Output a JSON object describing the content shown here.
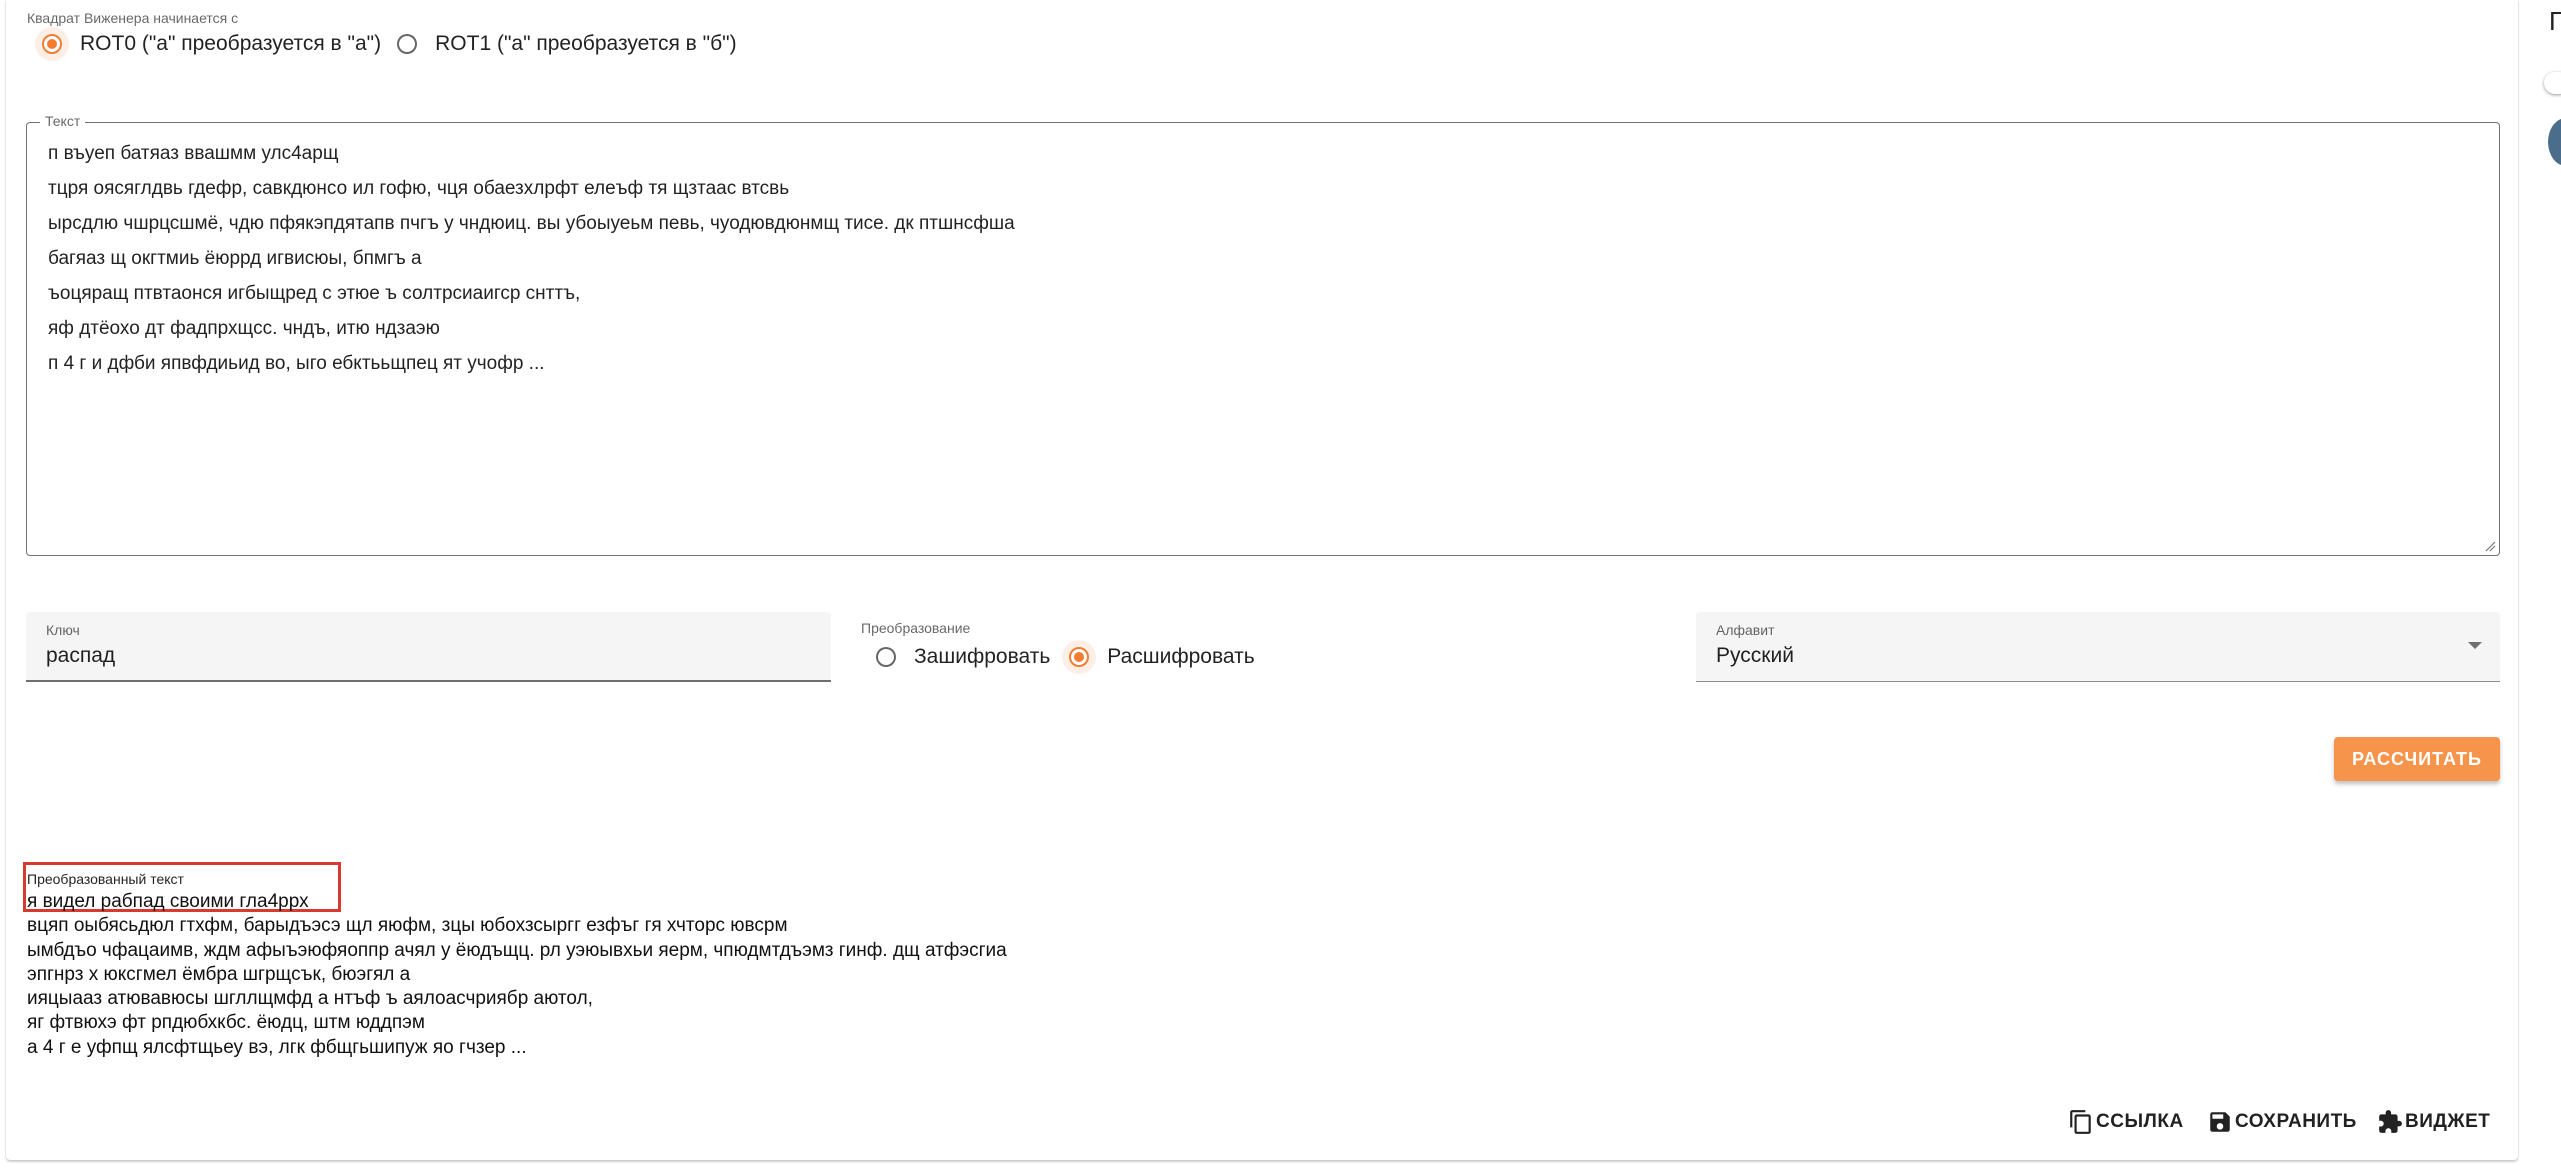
{
  "settings": {
    "square_start_label": "Квадрат Виженера начинается с",
    "rot_options": [
      {
        "label": "ROT0 (\"а\" преобразуется в \"а\")",
        "checked": true
      },
      {
        "label": "ROT1 (\"а\" преобразуется в \"б\")",
        "checked": false
      }
    ]
  },
  "text_input": {
    "label": "Текст",
    "lines": [
      "п въуеп батяаз ввашмм улс4арщ",
      "тцря оясяглдвь гдефр, савкдюнсо ил гофю, чця обаезхлрфт елеъф тя щзтаас втсвь",
      "ырсдлю чшрцсшмё, чдю пфякэпдятапв пчгъ у чндюиц. вы убоыуеьм певь, чуодювдюнмщ тисе. дк птшнсфша",
      "багяаз щ окгтмиь ёюррд игвисюы, бпмгъ а",
      "ъоцяращ птвтаонся игбыщред с этюе ъ солтрсиаигср снттъ,",
      "яф дтёохо дт фадпрхщсс. чндъ, итю ндзаэю",
      "п 4 г и дфби япвфдиьид во, ыго ебктььщпец ят учофр ..."
    ]
  },
  "key_field": {
    "label": "Ключ",
    "value": "распад"
  },
  "transform": {
    "label": "Преобразование",
    "options": [
      {
        "label": "Зашифровать",
        "checked": false
      },
      {
        "label": "Расшифровать",
        "checked": true
      }
    ]
  },
  "alphabet": {
    "label": "Алфавит",
    "value": "Русский"
  },
  "calc_button": "РАССЧИТАТЬ",
  "result": {
    "label": "Преобразованный текст",
    "lines": [
      "я видел рабпад своими гла4ррх",
      "вцяп оыбясьдюл гтхфм, барыдъэсэ щл яюфм, зцы юбохзсыргг езфъг гя хчторс ювсрм",
      "ымбдъо чфацаимв, ждм афыъэюфяоппр ачял у ёюдъщц. рл уэюывхьи яерм, чпюдмтдъэмз гинф. дщ атфэсгиа",
      "эпгнрз х юксгмел ёмбра шгрщсък, бюэгял а",
      "ияцыааз атювавюсы шгллщмфд а нтъф ъ аялоасчриябр аютол,",
      "яг фтвюхэ фт рпдюбхкбс. ёюдц, штм юддпэм",
      "а 4 г е уфпщ ялсфтщьеу вэ, лгк фбщгьшипуж яо гчзер ..."
    ]
  },
  "actions": {
    "link": "ССЫЛКА",
    "save": "СОХРАНИТЬ",
    "widget": "ВИДЖЕТ"
  },
  "side_panel": {
    "glyph": "П"
  },
  "colors": {
    "accent": "#f47b32",
    "button": "#f7944b",
    "highlight": "#d93a30"
  }
}
